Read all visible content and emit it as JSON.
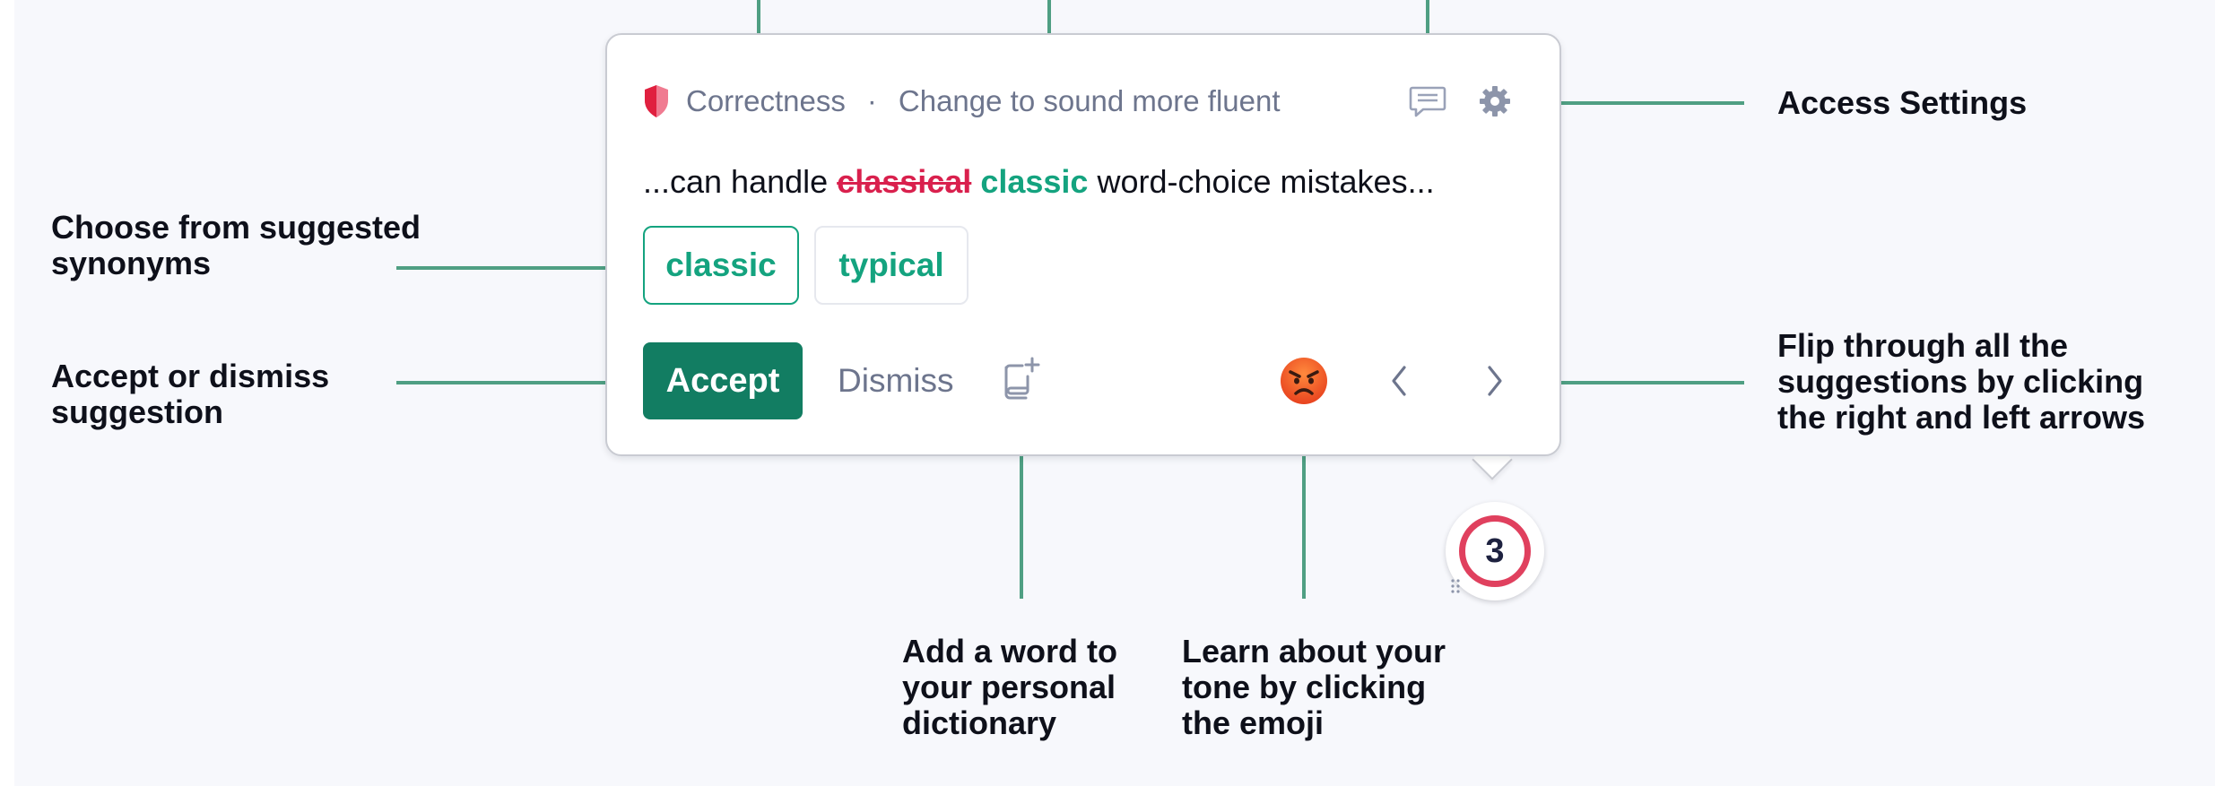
{
  "popup": {
    "category": "Correctness",
    "separator": "·",
    "description": "Change to sound more fluent",
    "sentence": {
      "before": "...can handle ",
      "removed": "classical",
      "inserted": "classic",
      "after": " word-choice mistakes..."
    },
    "synonyms": [
      {
        "label": "classic",
        "selected": true
      },
      {
        "label": "typical",
        "selected": false
      }
    ],
    "accept_label": "Accept",
    "dismiss_label": "Dismiss",
    "suggestion_count": "3"
  },
  "annotations": {
    "access_settings": "Access Settings",
    "choose_synonyms": "Choose from suggested\nsynonyms",
    "accept_dismiss": "Accept or dismiss\nsuggestion",
    "flip_suggestions": "Flip through all the\nsuggestions by clicking\nthe right and left arrows",
    "add_word": "Add a word to\nyour personal\ndictionary",
    "learn_tone": "Learn about your\ntone by clicking\nthe emoji"
  },
  "icons": {
    "shield": "shield-icon",
    "feedback": "comment-icon",
    "settings": "gear-icon",
    "dictionary": "add-to-dictionary-icon",
    "tone": "angry-face-emoji",
    "prev": "chevron-left-icon",
    "next": "chevron-right-icon"
  },
  "colors": {
    "accent_green": "#14a37f",
    "accept_button": "#127d62",
    "connector": "#4f9f83",
    "error_red": "#d9204d",
    "badge_ring": "#e0405e",
    "muted_text": "#6d758d"
  }
}
